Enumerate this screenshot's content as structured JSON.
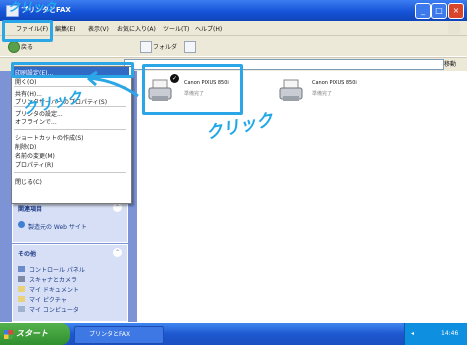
{
  "window": {
    "title": "プリンタとFAX",
    "min": "_",
    "max": "□",
    "close": "×"
  },
  "menu": {
    "file": "ファイル(F)",
    "edit": "編集(E)",
    "view": "表示(V)",
    "favorites": "お気に入り(A)",
    "tools": "ツール(T)",
    "help": "ヘルプ(H)"
  },
  "toolbar": {
    "back": "戻る",
    "search": "検索",
    "folders": "フォルダ"
  },
  "address": {
    "go": "移動"
  },
  "file_menu": {
    "items": [
      "印刷設定(E)...",
      "開く(O)",
      "共有(H)...",
      "プリンタサーバーのプロパティ(S)",
      "プリンタの設定...",
      "オフラインで...",
      "ショートカットの作成(S)",
      "削除(D)",
      "名前の変更(M)",
      "プロパティ(R)",
      "閉じる(C)"
    ]
  },
  "left_pane": {
    "see_also_title": "関連項目",
    "see_also_link": "製造元の Web サイト",
    "other_title": "その他",
    "other_links": [
      "コントロール パネル",
      "スキャナとカメラ",
      "マイ ドキュメント",
      "マイ ピクチャ",
      "マイ コンピュータ"
    ]
  },
  "printers": [
    {
      "name": "Canon PIXUS 850i",
      "status": "準備完了"
    },
    {
      "name": "Canon PIXUS 850i",
      "status": "準備完了"
    }
  ],
  "annotations": {
    "click_top": "クリック",
    "click_menu": "クリック",
    "click_printer": "クリック"
  },
  "taskbar": {
    "start": "スタート",
    "task": "プリンタとFAX",
    "time": "14:46"
  },
  "colors": {
    "xp_blue": "#1554d8",
    "menu_bg": "#ece9d8",
    "task_pane": "#7c93d6",
    "annotation": "#2ba6e6",
    "start_green": "#2f8f2d"
  }
}
